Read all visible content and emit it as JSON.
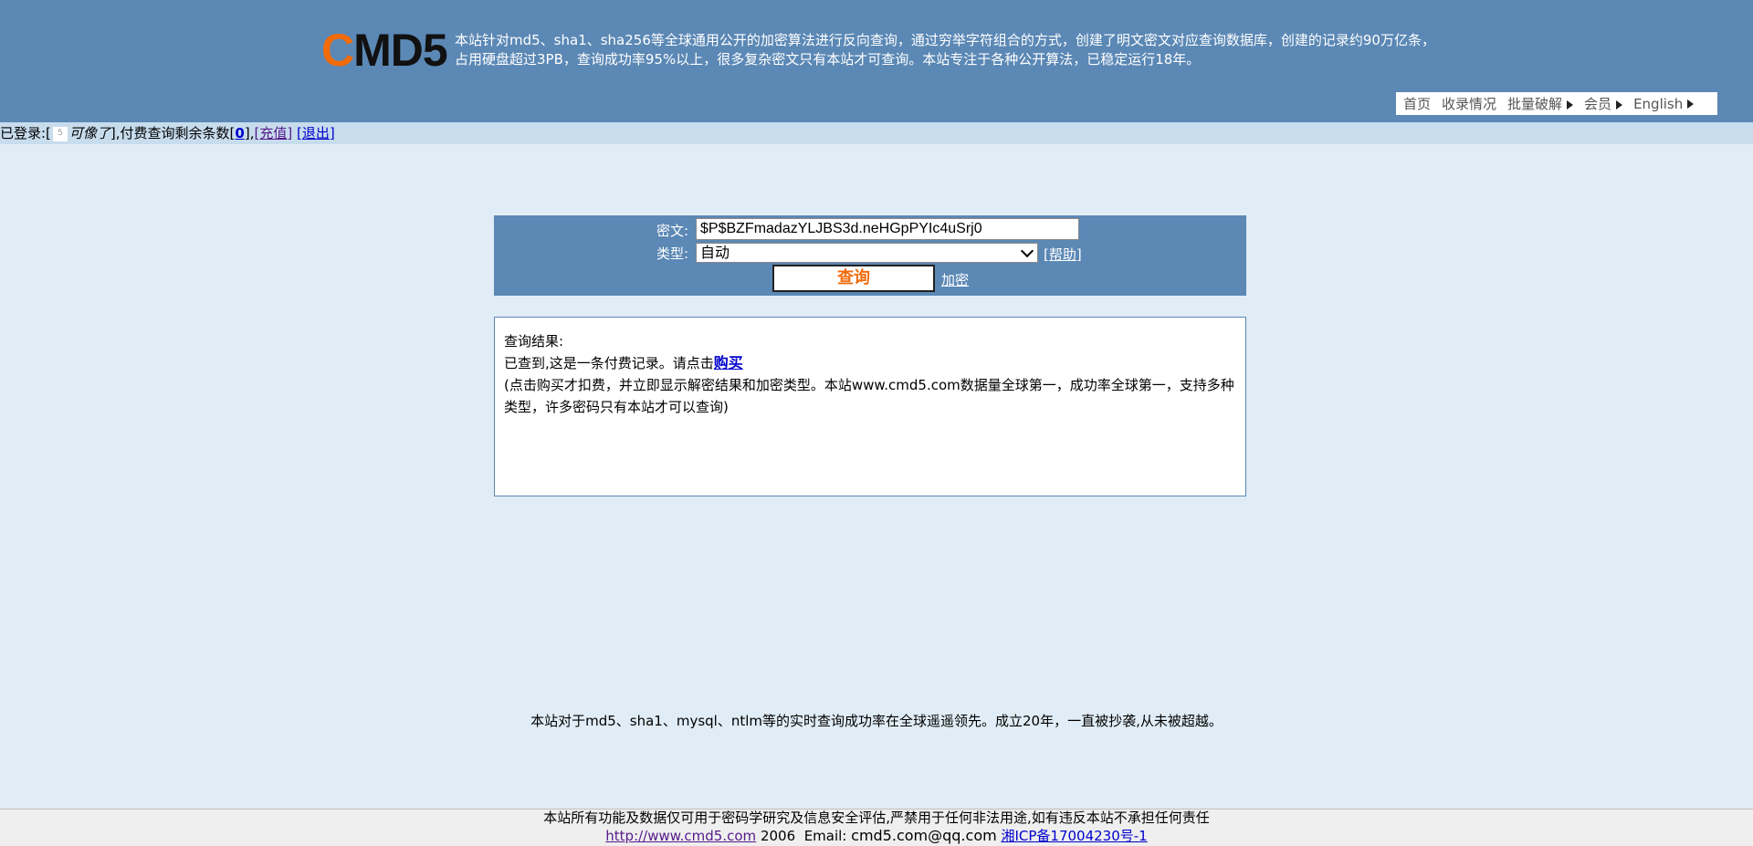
{
  "header": {
    "logo": {
      "c": "C",
      "rest": "MD5"
    },
    "intro_line1": "本站针对md5、sha1、sha256等全球通用公开的加密算法进行反向查询，通过穷举字符组合的方式，创建了明文密文对应查询数据库，创建的记录约90万亿条，",
    "intro_line2": "占用硬盘超过3PB，查询成功率95%以上，很多复杂密文只有本站才可查询。本站专注于各种公开算法，已稳定运行18年。",
    "nav": [
      {
        "label": "首页",
        "arrow": false
      },
      {
        "label": "收录情况",
        "arrow": false
      },
      {
        "label": "批量破解",
        "arrow": true
      },
      {
        "label": "会员",
        "arrow": true
      },
      {
        "label": "English",
        "arrow": true
      }
    ]
  },
  "login": {
    "prefix": "已登录:[",
    "username": "可像了",
    "mid": "],付费查询剩余条数[",
    "count": "0",
    "after_count": "],",
    "recharge": "[充值]",
    "logout": "[退出]"
  },
  "form": {
    "cipher_label": "密文:",
    "cipher_value": "$P$BZFmadazYLJBS3d.neHGpPYIc4uSrj0",
    "type_label": "类型:",
    "type_value": "自动",
    "help": "[帮助]",
    "query_button": "查询",
    "encrypt_link": "加密"
  },
  "result": {
    "title": "查询结果:",
    "line2_prefix": "已查到,这是一条付费记录。请点击",
    "buy": "购买",
    "desc": "(点击购买才扣费，并立即显示解密结果和加密类型。本站www.cmd5.com数据量全球第一，成功率全球第一，支持多种类型，许多密码只有本站才可以查询)"
  },
  "middle_text": "本站对于md5、sha1、mysql、ntlm等的实时查询成功率在全球遥遥领先。成立20年，一直被抄袭,从未被超越。",
  "footer": {
    "line1": "本站所有功能及数据仅可用于密码学研究及信息安全评估,严禁用于任何非法用途,如有违反本站不承担任何责任",
    "url": "http://www.cmd5.com",
    "year": "2006",
    "email_label": "Email:",
    "email": "cmd5.com@qq.com",
    "icp": "湘ICP备17004230号-1"
  },
  "colors": {
    "header_bg": "#5b88b5",
    "page_bg": "#e1edf6",
    "logo_accent": "#f26b0a"
  }
}
